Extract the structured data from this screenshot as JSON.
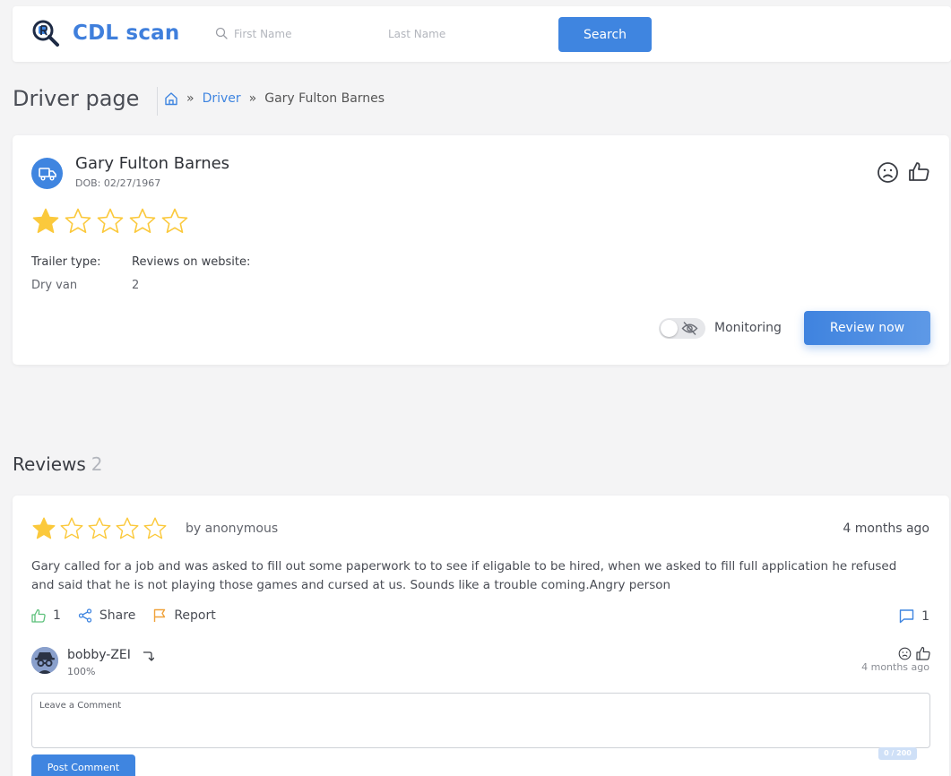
{
  "header": {
    "logo_text": "CDL scan",
    "first_name_placeholder": "First Name",
    "last_name_placeholder": "Last Name",
    "search_label": "Search"
  },
  "breadcrumb": {
    "page_title": "Driver page",
    "link": "Driver",
    "current": "Gary Fulton Barnes",
    "separator": "»"
  },
  "driver": {
    "name": "Gary Fulton Barnes",
    "dob": "DOB: 02/27/1967",
    "rating": 1,
    "rating_max": 5,
    "trailer_label": "Trailer type:",
    "trailer_value": "Dry van",
    "reviews_label": "Reviews on website:",
    "reviews_value": "2",
    "monitoring_label": "Monitoring",
    "monitoring_on": false,
    "review_button": "Review now"
  },
  "reviews": {
    "title": "Reviews",
    "count": "2",
    "items": [
      {
        "rating": 1,
        "author": "by anonymous",
        "time": "4 months ago",
        "text": "Gary called for a job and was asked to fill out some paperwork to to see if eligable to be hired, when we asked to fill full application he refused and said that he is not playing those games and cursed at us. Sounds like a trouble coming.Angry person",
        "likes": "1",
        "share_label": "Share",
        "report_label": "Report",
        "comments": "1",
        "commenter": {
          "name": "bobby-ZEI",
          "score": "100%",
          "time": "4 months ago"
        },
        "comment_placeholder": "Leave a Comment",
        "char_count": "0 / 200",
        "post_label": "Post Comment"
      }
    ]
  },
  "colors": {
    "accent": "#3f85e0",
    "star": "#fbc93c",
    "like": "#5cc07a",
    "report": "#f0a23a"
  }
}
